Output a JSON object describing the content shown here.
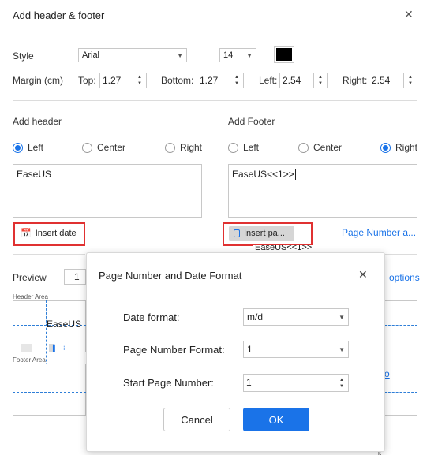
{
  "dialog": {
    "title": "Add header & footer"
  },
  "style": {
    "label": "Style",
    "font": "Arial",
    "size": "14",
    "color": "#000000"
  },
  "margin": {
    "label": "Margin (cm)",
    "top_label": "Top:",
    "top": "1.27",
    "bottom_label": "Bottom:",
    "bottom": "1.27",
    "left_label": "Left:",
    "left": "2.54",
    "right_label": "Right:",
    "right": "2.54"
  },
  "header": {
    "title": "Add header",
    "align_left": "Left",
    "align_center": "Center",
    "align_right": "Right",
    "selected": "Left",
    "text": "EaseUS",
    "insert_date": "Insert date"
  },
  "footer": {
    "title": "Add Footer",
    "align_left": "Left",
    "align_center": "Center",
    "align_right": "Right",
    "selected": "Right",
    "text": "EaseUS<<1>>",
    "insert_page": "Insert pa...",
    "page_number_link": "Page Number a...",
    "tooltip_text": "EaseUS<<1>>"
  },
  "preview": {
    "label": "Preview",
    "page": "1",
    "options_link": "options",
    "header_area": "Header Area",
    "footer_area": "Footer Area",
    "header_text": "EaseUS",
    "footer_partial": "o"
  },
  "modal": {
    "title": "Page Number and Date Format",
    "date_format_label": "Date format:",
    "date_format": "m/d",
    "page_number_format_label": "Page Number Format:",
    "page_number_format": "1",
    "start_page_label": "Start Page Number:",
    "start_page": "1",
    "cancel": "Cancel",
    "ok": "OK"
  },
  "colors": {
    "accent": "#1a73e8",
    "highlight": "#e03131"
  }
}
